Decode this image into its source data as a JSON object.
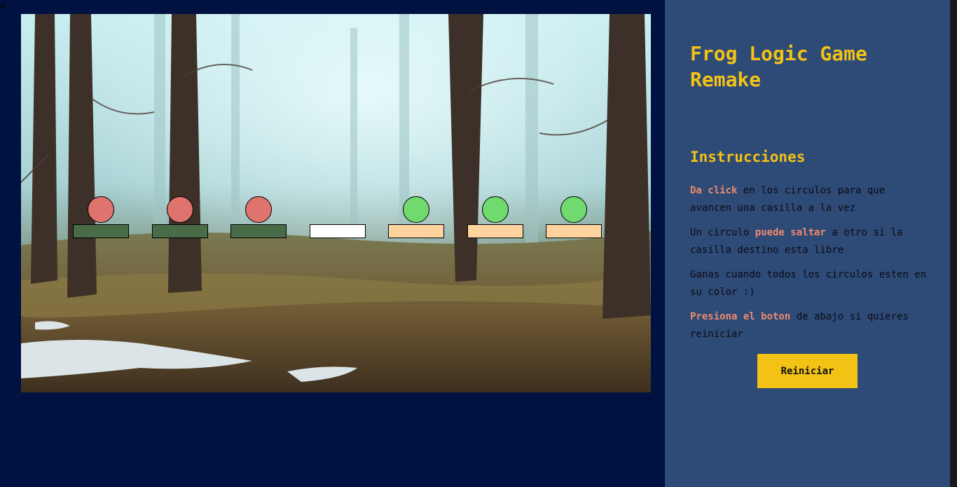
{
  "nav": {
    "back_icon": "chevron-left-icon",
    "back_glyph": "<"
  },
  "game": {
    "colors": {
      "red_circle": "#df736e",
      "green_circle": "#71da6e",
      "dark_green_tile": "#4a6b48",
      "empty_tile": "#ffffff",
      "peach_tile": "#ffd39e"
    },
    "slots": [
      {
        "circle": "red",
        "tile": "dark_green"
      },
      {
        "circle": "red",
        "tile": "dark_green"
      },
      {
        "circle": "red",
        "tile": "dark_green"
      },
      {
        "circle": null,
        "tile": "empty"
      },
      {
        "circle": "green",
        "tile": "peach"
      },
      {
        "circle": "green",
        "tile": "peach"
      },
      {
        "circle": "green",
        "tile": "peach"
      }
    ]
  },
  "panel": {
    "title": "Frog Logic Game Remake",
    "instructions_heading": "Instrucciones",
    "instructions": [
      {
        "bold": "Da click",
        "text": " en los circulos para que avancen una casilla a la vez"
      },
      {
        "prefix": "Un circulo ",
        "bold": "puede saltar",
        "text": " a otro si la casilla destino esta libre"
      },
      {
        "text": "Ganas cuando todos los circulos esten en su color :)"
      },
      {
        "bold": "Presiona el boton",
        "text": " de abajo si quieres reiniciar"
      }
    ],
    "restart_label": "Reiniciar"
  },
  "theme": {
    "accent": "#f2c314",
    "highlight": "#ef8a6d",
    "page_bg": "#001242",
    "panel_bg": "#2e4a77"
  }
}
